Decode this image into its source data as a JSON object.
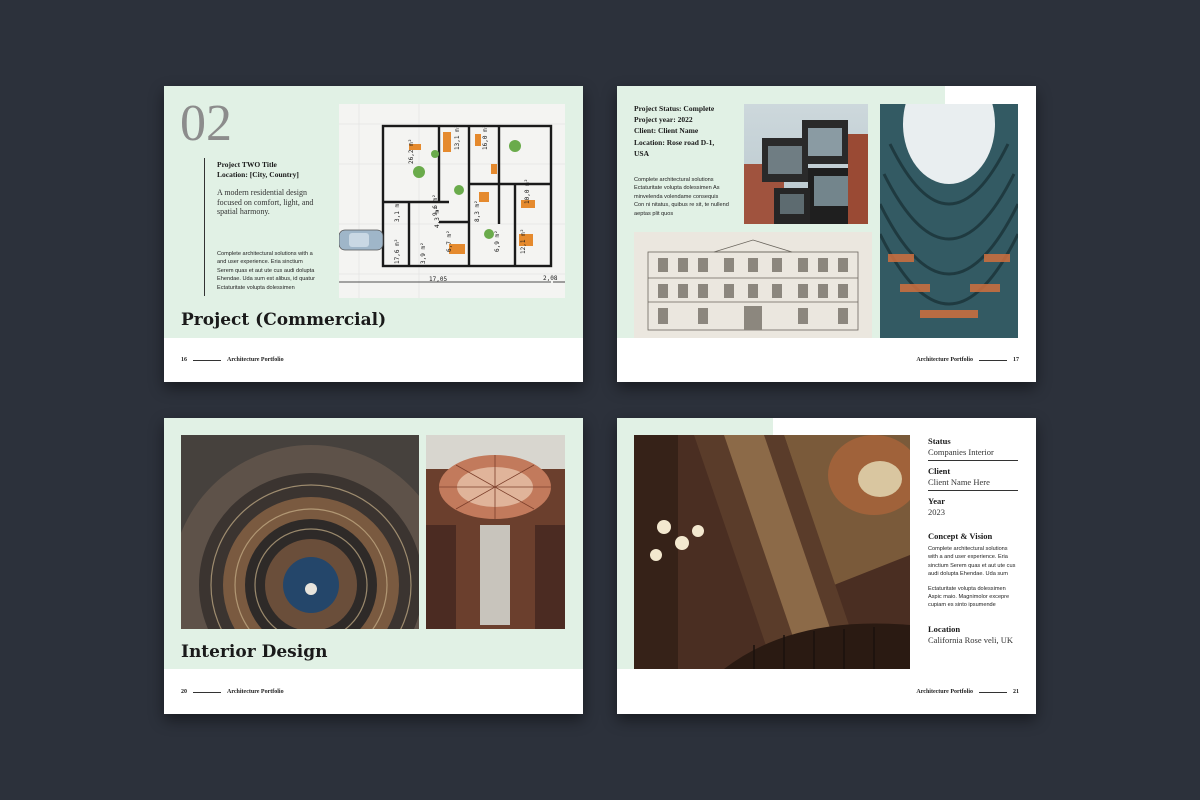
{
  "colors": {
    "background": "#2c313b",
    "mint": "#e1f1e5",
    "numeral": "#8c8c8c"
  },
  "page1": {
    "numeral": "02",
    "project_title": "Project TWO Title",
    "location": "Location: [City, Country]",
    "description": "A modern residential design focused on comfort, light, and spatial harmony.",
    "body": "Complete architectural solutions with a and user experience. Eria sinctium Serem quas et aut ute cus audi dolupta Ehendae. Uda sum est alibus, id quatur Ectaturitate volupta dolessimen",
    "heading": "Project (Commercial)",
    "page_number": "16",
    "footer": "Architecture Portfolio",
    "plan_labels": [
      "13,1 m²",
      "16,0 m²",
      "26,2 m²",
      "10,0 m²",
      "8,3 m²",
      "9,6 m²",
      "3,1 m²",
      "6,7 m²",
      "6,9 m²",
      "12,1 m²",
      "17,6 m²",
      "3,9 m²",
      "4,3 m²"
    ],
    "plan_dimensions": [
      "17,05",
      "2,08"
    ]
  },
  "page2": {
    "status": "Project Status: Complete",
    "year": "Project year: 2022",
    "client": "Client: Client Name",
    "location": "Location: Rose road D-1, USA",
    "body": "Complete architectural solutions Ectaturitate volupta dolessimen As minvelenda volendame consequis Con ni nitatus, quibus re sit, te nullend aeptas plit quos",
    "page_number": "17",
    "footer": "Architecture Portfolio"
  },
  "page3": {
    "heading": "Interior Design",
    "page_number": "20",
    "footer": "Architecture Portfolio"
  },
  "page4": {
    "status_label": "Status",
    "status_value": "Companies Interior",
    "client_label": "Client",
    "client_value": "Client Name Here",
    "year_label": "Year",
    "year_value": "2023",
    "concept_label": "Concept & Vision",
    "concept_body1": "Complete architectural solutions with a and user experience. Eria sinctium Serem quas et aut ute cus audi dolupta Ehendae. Uda sum",
    "concept_body2": "Ectaturitate volupta dolessimen Aspic maio. Magnimolor excepre cupiam es sinto ipsumende",
    "location_label": "Location",
    "location_value": "California Rose veli, UK",
    "page_number": "21",
    "footer": "Architecture Portfolio"
  }
}
